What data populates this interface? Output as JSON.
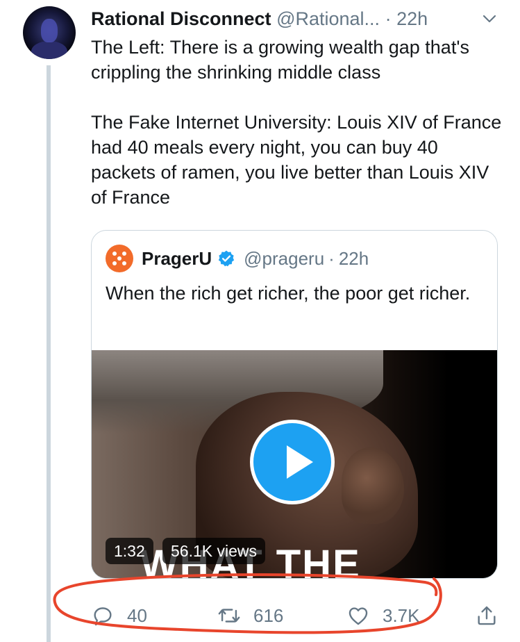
{
  "tweet": {
    "display_name": "Rational Disconnect",
    "handle": "@Rational...",
    "separator": "·",
    "time": "22h",
    "menu_icon": "chevron-down-icon",
    "body": [
      "The Left: There is a growing wealth gap that's crippling the shrinking middle class",
      "The Fake Internet University: Louis XIV of France had 40 meals every night, you can buy 40 packets of ramen, you live better than Louis XIV of France"
    ]
  },
  "quoted_tweet": {
    "display_name": "PragerU",
    "verified": true,
    "handle": "@prageru",
    "separator": "·",
    "time": "22h",
    "text": "When the rich get richer, the poor get richer.",
    "video": {
      "duration": "1:32",
      "views": "56.1K views",
      "caption_overlay": "WHAT THE"
    }
  },
  "actions": {
    "reply_count": "40",
    "retweet_count": "616",
    "like_count": "3.7K"
  },
  "annotation": {
    "color": "#e8452c"
  },
  "colors": {
    "accent": "#1da1f2",
    "secondary_text": "#657786",
    "brand_orange": "#f26b2a"
  }
}
